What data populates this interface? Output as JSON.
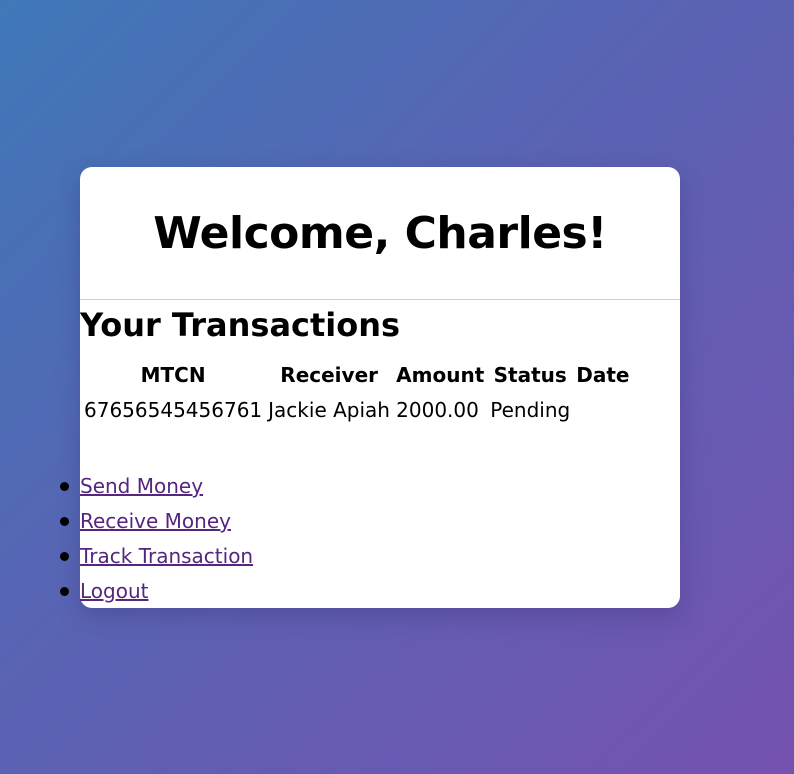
{
  "header": {
    "title": "Welcome, Charles!"
  },
  "transactions": {
    "heading": "Your Transactions",
    "columns": [
      "MTCN",
      "Receiver",
      "Amount",
      "Status",
      "Date"
    ],
    "rows": [
      {
        "mtcn": "67656545456761",
        "receiver": "Jackie Apiah",
        "amount": "2000.00",
        "status": "Pending",
        "date": ""
      }
    ]
  },
  "nav": {
    "links": [
      {
        "label": "Send Money"
      },
      {
        "label": "Receive Money"
      },
      {
        "label": "Track Transaction"
      },
      {
        "label": "Logout"
      }
    ]
  },
  "colors": {
    "gradient_start": "#3f78b8",
    "gradient_end": "#7552b0",
    "link": "#55267f",
    "card": "#ffffff"
  }
}
